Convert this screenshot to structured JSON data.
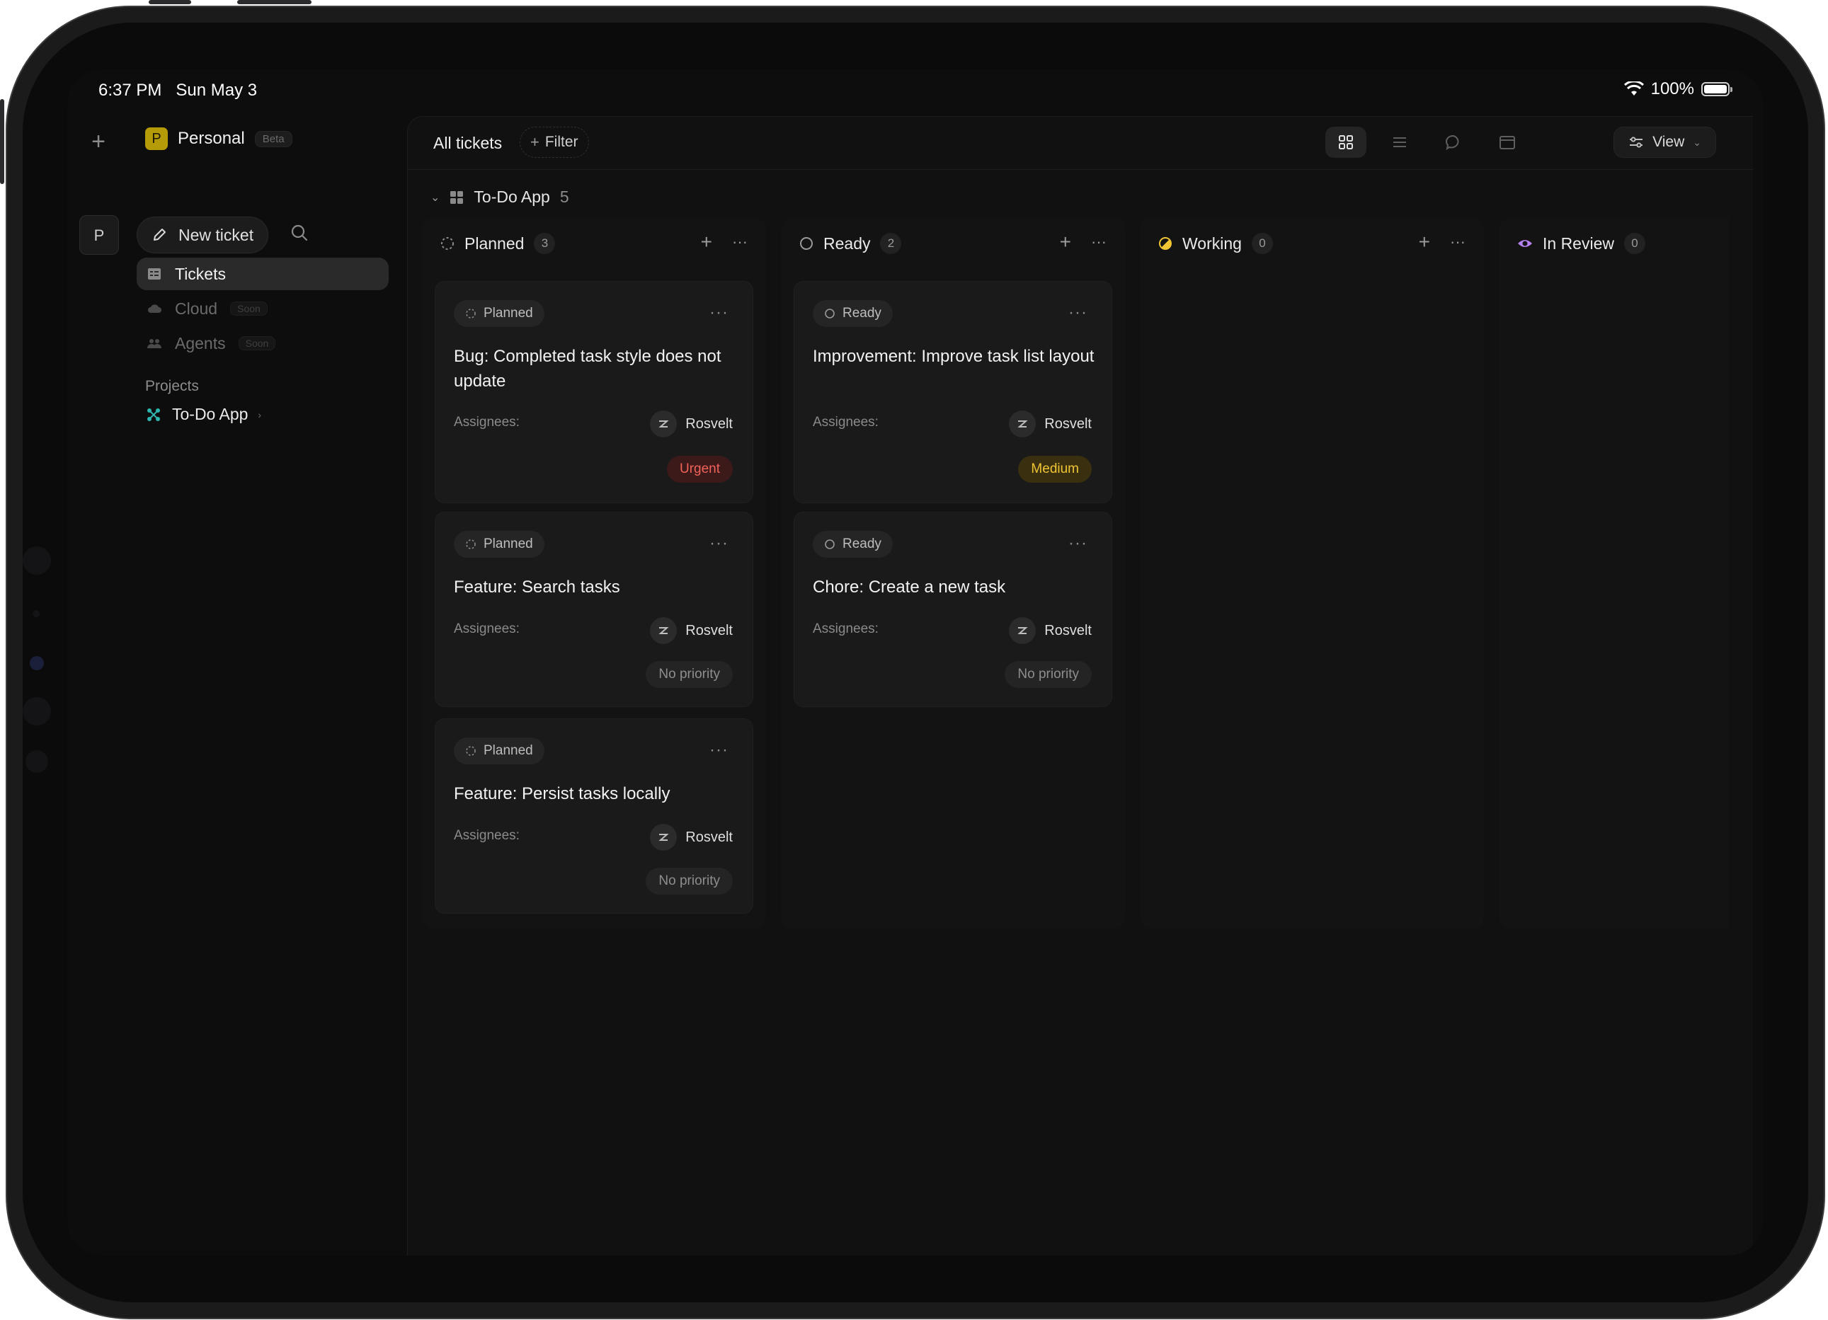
{
  "status_bar": {
    "time": "6:37 PM",
    "date": "Sun May 3",
    "battery": "100%"
  },
  "rail": {
    "workspace_initial": "P"
  },
  "sidebar": {
    "workspace": {
      "initial": "P",
      "name": "Personal",
      "badge": "Beta"
    },
    "new_ticket_label": "New ticket",
    "nav": [
      {
        "label": "Tickets",
        "icon": "tickets-icon",
        "active": true,
        "badge": ""
      },
      {
        "label": "Cloud",
        "icon": "cloud-icon",
        "active": false,
        "badge": "Soon"
      },
      {
        "label": "Agents",
        "icon": "agents-icon",
        "active": false,
        "badge": "Soon"
      }
    ],
    "projects_label": "Projects",
    "projects": [
      {
        "name": "To-Do App",
        "icon": "project-icon"
      }
    ]
  },
  "topbar": {
    "title": "All tickets",
    "filter_label": "Filter",
    "view_label": "View"
  },
  "group": {
    "name": "To-Do App",
    "count": "5"
  },
  "columns": [
    {
      "status": "Planned",
      "count": "3",
      "icon": "planned-status-icon"
    },
    {
      "status": "Ready",
      "count": "2",
      "icon": "ready-status-icon"
    },
    {
      "status": "Working",
      "count": "0",
      "icon": "working-status-icon"
    },
    {
      "status": "In Review",
      "count": "0",
      "icon": "in-review-status-icon"
    }
  ],
  "cards": {
    "planned": [
      {
        "status": "Planned",
        "title": "Bug: Completed task style does not update",
        "assignees_label": "Assignees:",
        "assignee": "Rosvelt",
        "priority": "Urgent"
      },
      {
        "status": "Planned",
        "title": "Feature: Search tasks",
        "assignees_label": "Assignees:",
        "assignee": "Rosvelt",
        "priority": "No priority"
      },
      {
        "status": "Planned",
        "title": "Feature: Persist tasks locally",
        "assignees_label": "Assignees:",
        "assignee": "Rosvelt",
        "priority": "No priority"
      }
    ],
    "ready": [
      {
        "status": "Ready",
        "title": "Improvement: Improve task list layout",
        "assignees_label": "Assignees:",
        "assignee": "Rosvelt",
        "priority": "Medium"
      },
      {
        "status": "Ready",
        "title": "Chore: Create a new task",
        "assignees_label": "Assignees:",
        "assignee": "Rosvelt",
        "priority": "No priority"
      }
    ]
  },
  "colors": {
    "urgent": "#f0625a",
    "medium": "#f0c534",
    "working": "#f0c534",
    "in_review": "#b580f0",
    "workspace_badge": "#b59b08"
  }
}
